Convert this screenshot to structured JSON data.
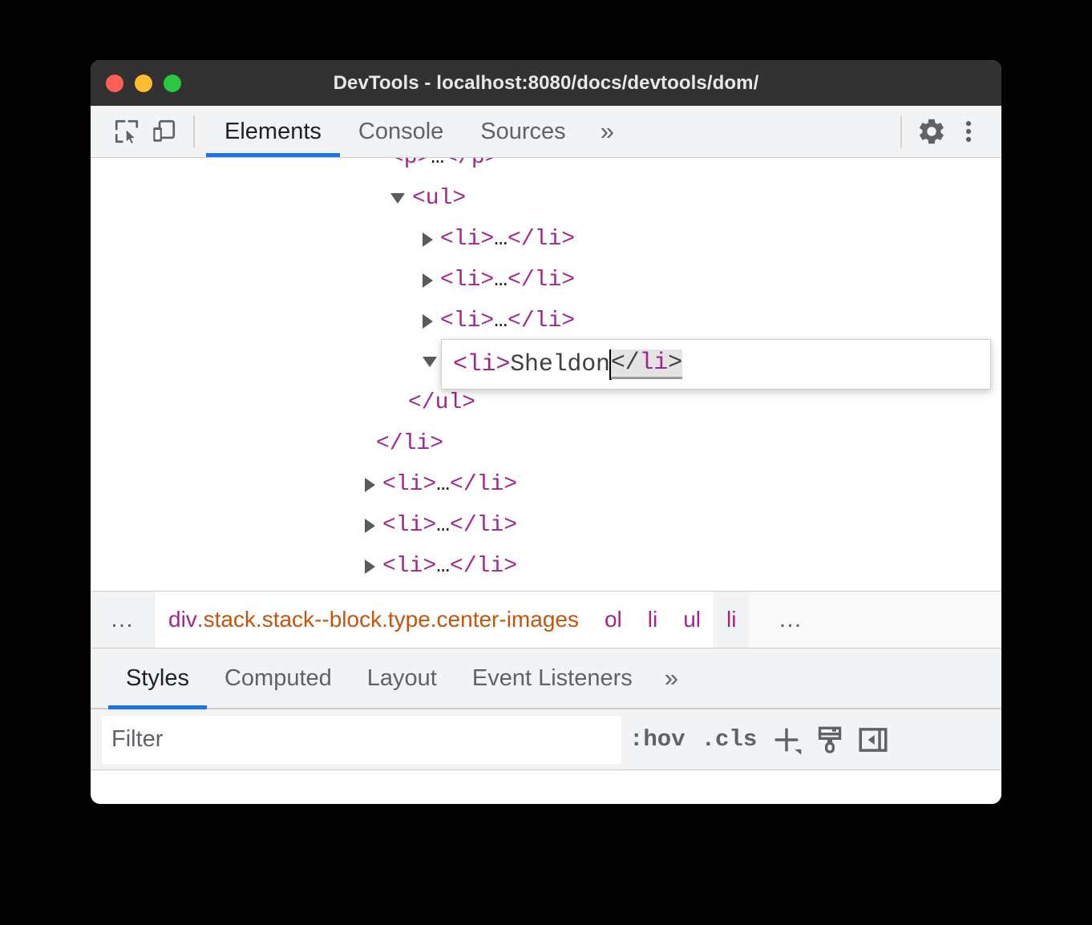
{
  "window": {
    "title": "DevTools - localhost:8080/docs/devtools/dom/",
    "traffic_lights": {
      "close_color": "#ff5f57",
      "minimize_color": "#ffbd2e",
      "maximize_color": "#28c840"
    }
  },
  "toolbar": {
    "inspect_icon": "inspect-element-icon",
    "device_icon": "device-toolbar-icon",
    "tabs": [
      {
        "label": "Elements",
        "active": true
      },
      {
        "label": "Console",
        "active": false
      },
      {
        "label": "Sources",
        "active": false
      }
    ],
    "more_tabs_label": "»",
    "settings_icon": "gear-icon",
    "menu_icon": "more-vertical-icon",
    "accent_color": "#1a73e8"
  },
  "dom_tree": {
    "cut_row": {
      "text_open": "<p>",
      "ellipsis": "…",
      "text_close": "</p>"
    },
    "rows": [
      {
        "indent": 1,
        "twisty": "expanded",
        "text": "<ul>",
        "kind": "open"
      },
      {
        "indent": 2,
        "twisty": "collapsed",
        "open": "<li>",
        "ellipsis": "…",
        "close": "</li>",
        "kind": "collapsed"
      },
      {
        "indent": 2,
        "twisty": "collapsed",
        "open": "<li>",
        "ellipsis": "…",
        "close": "</li>",
        "kind": "collapsed"
      },
      {
        "indent": 2,
        "twisty": "collapsed",
        "open": "<li>",
        "ellipsis": "…",
        "close": "</li>",
        "kind": "collapsed"
      },
      {
        "indent": 2,
        "twisty": "expanded",
        "text": "",
        "kind": "editing"
      },
      {
        "indent": 1,
        "twisty": "none",
        "text": "</ul>",
        "kind": "close"
      },
      {
        "indent": 0,
        "twisty": "none",
        "text": "</li>",
        "kind": "close"
      },
      {
        "indent": 0,
        "twisty": "collapsed",
        "open": "<li>",
        "ellipsis": "…",
        "close": "</li>",
        "kind": "collapsed"
      },
      {
        "indent": 0,
        "twisty": "collapsed",
        "open": "<li>",
        "ellipsis": "…",
        "close": "</li>",
        "kind": "collapsed"
      },
      {
        "indent": 0,
        "twisty": "collapsed",
        "open": "<li>",
        "ellipsis": "…",
        "close": "</li>",
        "kind": "collapsed"
      }
    ],
    "tag_color": "#a1268c"
  },
  "edit_box": {
    "open_tag": "<li>",
    "value": "Sheldon",
    "close_tag": "</li>",
    "caret_after": "Sheldon",
    "selection": "</li>"
  },
  "breadcrumb": {
    "left_overflow": "…",
    "right_overflow": "…",
    "items": [
      {
        "node": "div",
        "classes": ".stack.stack--block.type.center-images",
        "selected": false
      },
      {
        "node": "ol",
        "classes": "",
        "selected": false
      },
      {
        "node": "li",
        "classes": "",
        "selected": false
      },
      {
        "node": "ul",
        "classes": "",
        "selected": false
      },
      {
        "node": "li",
        "classes": "",
        "selected": true
      }
    ],
    "node_color": "#a1268c",
    "class_color": "#c2560d"
  },
  "styles_pane": {
    "tabs": [
      {
        "label": "Styles",
        "active": true
      },
      {
        "label": "Computed",
        "active": false
      },
      {
        "label": "Layout",
        "active": false
      },
      {
        "label": "Event Listeners",
        "active": false
      }
    ],
    "more_tabs_label": "»",
    "filter_placeholder": "Filter",
    "filter_value": "",
    "hov_label": ":hov",
    "cls_label": ".cls",
    "new_rule_icon": "plus-icon",
    "computed_icon": "paint-brush-icon",
    "sidebar_toggle_icon": "collapse-sidebar-icon"
  }
}
